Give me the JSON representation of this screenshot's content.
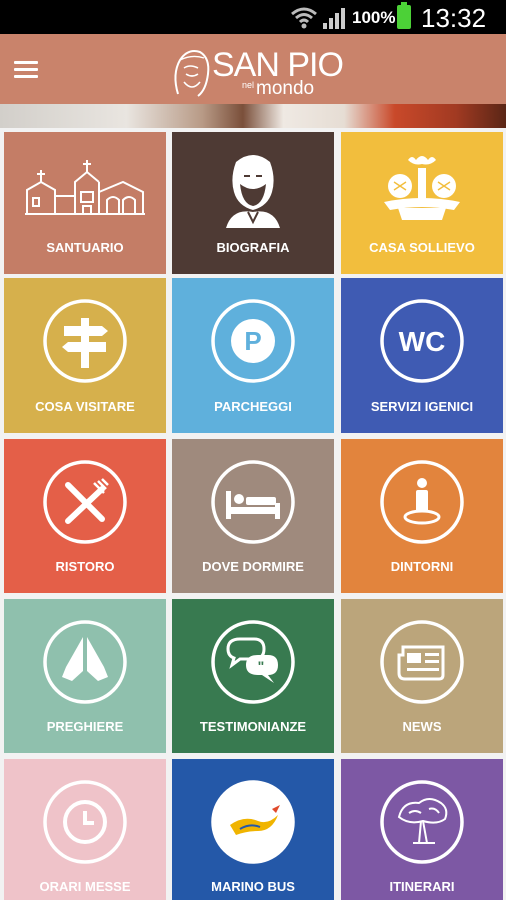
{
  "status_bar": {
    "battery": "100%",
    "time": "13:32"
  },
  "app_bar": {
    "logo_title": "SAN PIO",
    "logo_nel": "nel",
    "logo_mondo": "mondo"
  },
  "colors": {
    "app_bar": "#c9836b",
    "santuario": "#c47d66",
    "biografia": "#4e3a34",
    "casa_sollievo": "#f2be3d",
    "cosa_visitare": "#d6b04c",
    "parcheggi": "#5fb0dc",
    "servizi_igienici": "#3f5bb3",
    "ristoro": "#e45f48",
    "dove_dormire": "#9f8a7d",
    "dintorni": "#e2843d",
    "preghiere": "#8fc0ad",
    "testimonianze": "#387a50",
    "news": "#bba57b",
    "orari_messe": "#efc3c9",
    "marino_bus": "#2458a8",
    "itinerari": "#7d58a4"
  },
  "tiles": [
    {
      "label": "SANTUARIO",
      "icon": "church-icon"
    },
    {
      "label": "BIOGRAFIA",
      "icon": "padre-pio-portrait-icon"
    },
    {
      "label": "CASA SOLLIEVO",
      "icon": "hospital-emblem-icon"
    },
    {
      "label": "COSA VISITARE",
      "icon": "signpost-icon"
    },
    {
      "label": "PARCHEGGI",
      "icon": "parking-icon"
    },
    {
      "label": "SERVIZI IGENICI",
      "icon": "wc-icon"
    },
    {
      "label": "RISTORO",
      "icon": "knife-fork-icon"
    },
    {
      "label": "DOVE DORMIRE",
      "icon": "bed-icon"
    },
    {
      "label": "DINTORNI",
      "icon": "location-person-icon"
    },
    {
      "label": "PREGHIERE",
      "icon": "praying-hands-icon"
    },
    {
      "label": "TESTIMONIANZE",
      "icon": "speech-bubbles-icon"
    },
    {
      "label": "NEWS",
      "icon": "newspaper-icon"
    },
    {
      "label": "ORARI MESSE",
      "icon": "clock-icon",
      "wc_text": ""
    },
    {
      "label": "MARINO BUS",
      "icon": "marino-bus-logo-icon"
    },
    {
      "label": "ITINERARI",
      "icon": "tree-icon"
    }
  ],
  "wc_text": "WC",
  "parking_letter": "P"
}
